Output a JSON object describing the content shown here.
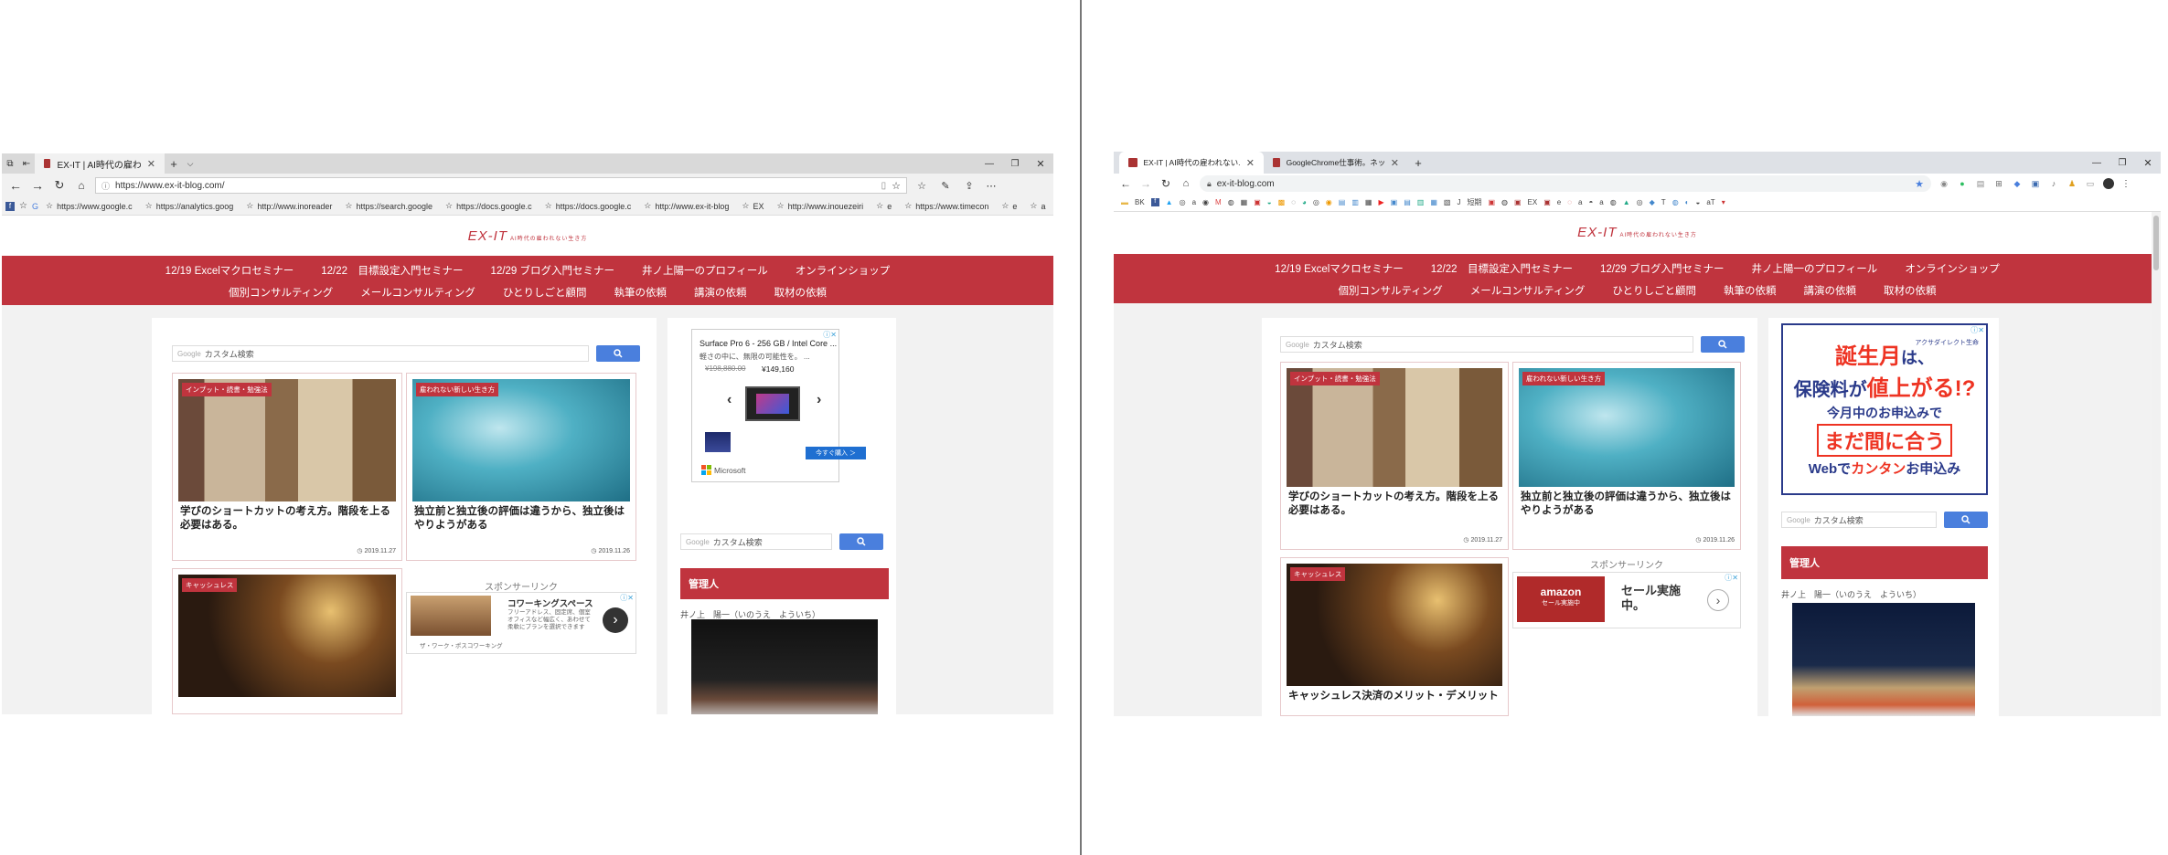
{
  "left": {
    "tabs": [
      {
        "title": "EX-IT | AI時代の雇われない"
      }
    ],
    "address": "https://www.ex-it-blog.com/",
    "bookmarks": [
      "https://www.google.c",
      "https://analytics.goog",
      "http://www.inoreader",
      "https://search.google",
      "https://docs.google.c",
      "https://docs.google.c",
      "http://www.ex-it-blog",
      "EX",
      "http://www.inouezeiri",
      "e",
      "https://www.timecon",
      "e",
      "a"
    ]
  },
  "right": {
    "tabs": [
      {
        "title": "EX-IT | AI時代の雇われない..."
      },
      {
        "title": "GoogleChrome仕事術。ネットを活..."
      }
    ],
    "address": "ex-it-blog.com",
    "bookmarks": [
      "BK",
      "a",
      "M",
      "J",
      "短期",
      "EX",
      "e",
      "a",
      "a",
      "aT"
    ]
  },
  "site": {
    "logo": "EX-IT",
    "tagline": "AI時代の雇われない生き方",
    "nav_row1": [
      "12/19 Excelマクロセミナー",
      "12/22　目標設定入門セミナー",
      "12/29 ブログ入門セミナー",
      "井ノ上陽一のプロフィール",
      "オンラインショップ"
    ],
    "nav_row2": [
      "個別コンサルティング",
      "メールコンサルティング",
      "ひとりしごと顧問",
      "執筆の依頼",
      "講演の依頼",
      "取材の依頼"
    ],
    "search": {
      "brand": "Google",
      "placeholder": "カスタム検索"
    },
    "posts": [
      {
        "category": "インプット・読書・勉強法",
        "title": "学びのショートカットの考え方。階段を上る必要はある。",
        "date": "2019.11.27"
      },
      {
        "category": "雇われない新しい生き方",
        "title": "独立前と独立後の評価は違うから、独立後はやりようがある",
        "date": "2019.11.26"
      },
      {
        "category": "キャッシュレス",
        "title": "キャッシュレス決済のメリット・デメリット",
        "date": ""
      }
    ],
    "sponsor_label": "スポンサーリンク",
    "admin_header": "管理人",
    "admin_name": "井ノ上　陽一（いのうえ　よういち）",
    "left_ads": {
      "surface_title": "Surface Pro 6 - 256 GB / Intel Core ...",
      "surface_desc": "軽さの中に、無限の可能性を。 ...",
      "price_old": "¥198,880.00",
      "price_new": "¥149,160",
      "buy_label": "今すぐ購入 ＞",
      "brand": "Microsoft",
      "coworking_title": "コワーキングスペース",
      "coworking_desc": "フリーアドレス、固定席、個室オフィスなど幅広く、あわせて柔軟にプランを選択できます",
      "coworking_brand": "ザ・ワーク・ポスコワーキング"
    },
    "right_ads": {
      "insurance_brand": "アクサダイレクト生命",
      "insurance_l1a": "誕生月",
      "insurance_l1b": "は、",
      "insurance_l2a": "保険料が",
      "insurance_l2b": "値上がる!?",
      "insurance_l3": "今月中のお申込みで",
      "insurance_l4": "まだ間に合う",
      "insurance_l5a": "Webで",
      "insurance_l5b": "カンタン",
      "insurance_l5c": "お申込み",
      "amazon_logo": "amazon",
      "amazon_sub": "セール実施中",
      "amazon_text": "セール実施中。"
    }
  },
  "colors": {
    "brand": "#c0343e",
    "search_btn": "#4a7fdd"
  }
}
